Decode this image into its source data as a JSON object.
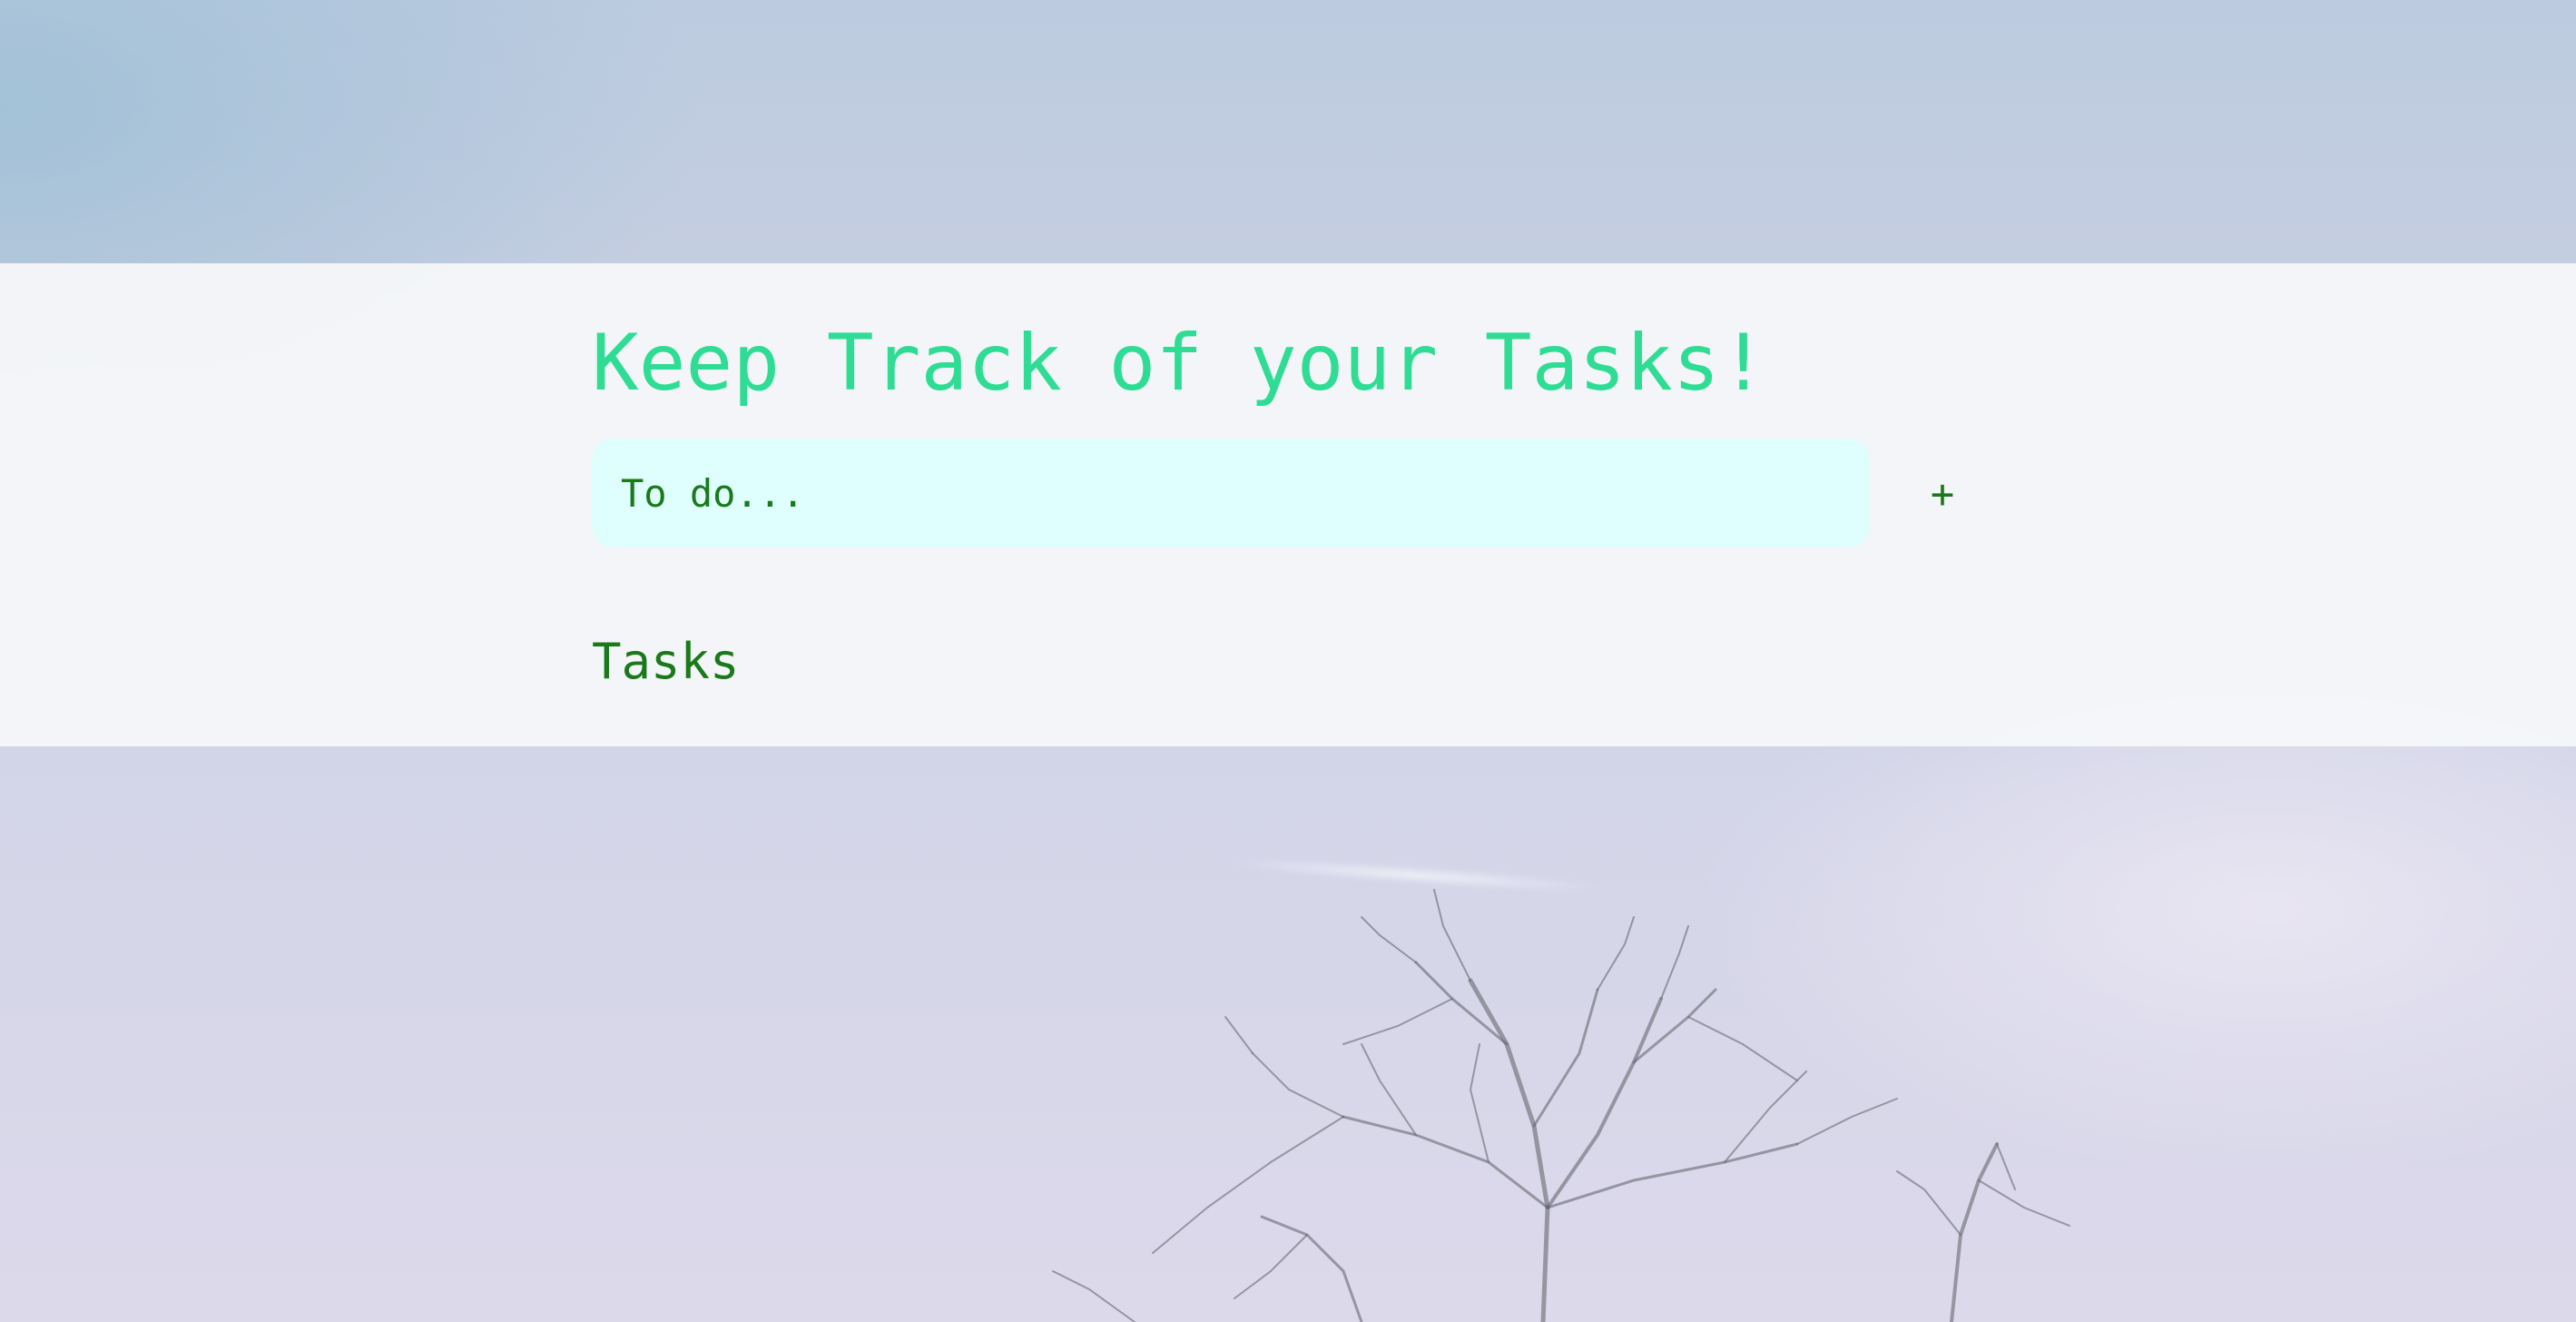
{
  "app": {
    "title": "Keep Track of your Tasks!"
  },
  "todo_input": {
    "placeholder": "To do...",
    "value": ""
  },
  "add_button": {
    "label": "+"
  },
  "tasks_section": {
    "heading": "Tasks",
    "items": []
  },
  "colors": {
    "title": "#2fdc94",
    "text": "#1a7a1a",
    "input_background": "#dfffff",
    "panel": "#f6f7fa"
  }
}
